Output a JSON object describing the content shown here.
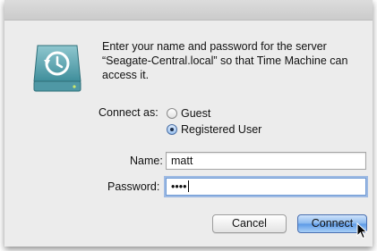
{
  "dialog": {
    "message": "Enter your name and password for the server “Seagate-Central.local” so that Time Machine can access it.",
    "connect_as": {
      "label": "Connect as:",
      "options": [
        {
          "label": "Guest",
          "selected": false
        },
        {
          "label": "Registered User",
          "selected": true
        }
      ]
    },
    "name": {
      "label": "Name:",
      "value": "matt"
    },
    "password": {
      "label": "Password:",
      "masked_value": "••••"
    },
    "buttons": {
      "cancel": "Cancel",
      "connect": "Connect"
    }
  },
  "icons": [
    "time-machine-disk-icon",
    "mouse-pointer-icon"
  ],
  "colors": {
    "dialog_bg": "#ececec",
    "focus_ring": "#5f91dc",
    "default_button": "#5b98e6"
  }
}
